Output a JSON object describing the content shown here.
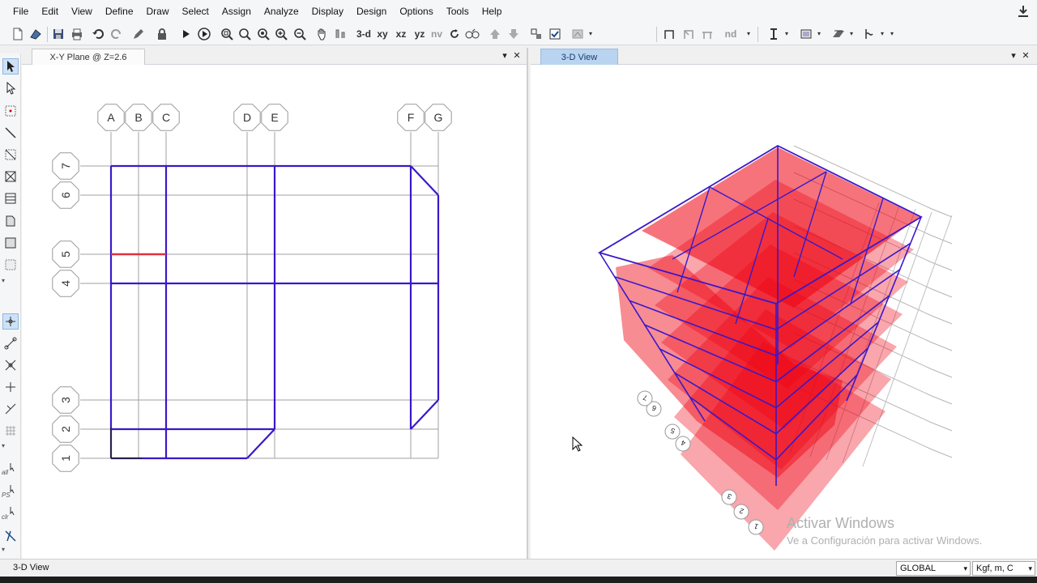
{
  "menu": [
    "File",
    "Edit",
    "View",
    "Define",
    "Draw",
    "Select",
    "Assign",
    "Analyze",
    "Display",
    "Design",
    "Options",
    "Tools",
    "Help"
  ],
  "toolbar": {
    "view_3d": "3-d",
    "view_xy": "xy",
    "view_xz": "xz",
    "view_yz": "yz",
    "view_nv": "nv",
    "nd": "nd"
  },
  "left_toolbar": {
    "label_all": "all",
    "label_ps": "PS",
    "label_clr": "clr"
  },
  "plan_panel": {
    "tab_title": "X-Y Plane @ Z=2.6",
    "grid_x_labels": [
      "A",
      "B",
      "C",
      "D",
      "E",
      "F",
      "G"
    ],
    "grid_y_labels": [
      "7",
      "6",
      "5",
      "4",
      "3",
      "2",
      "1"
    ]
  },
  "view3d_panel": {
    "tab_title": "3-D View",
    "grid_labels": [
      "1",
      "2",
      "3",
      "4",
      "5",
      "6",
      "7"
    ]
  },
  "status": {
    "text": "3-D View",
    "coord_system": "GLOBAL",
    "units": "Kgf, m, C"
  },
  "watermark": {
    "title": "Activar Windows",
    "subtitle": "Ve a Configuración para activar Windows."
  },
  "colors": {
    "frame_blue": "#3a18c8",
    "grid_gray": "#9a9a9a",
    "slab_red": "#ee0010",
    "highlight_red": "#e03040",
    "tab_active": "#b9d4f0"
  }
}
